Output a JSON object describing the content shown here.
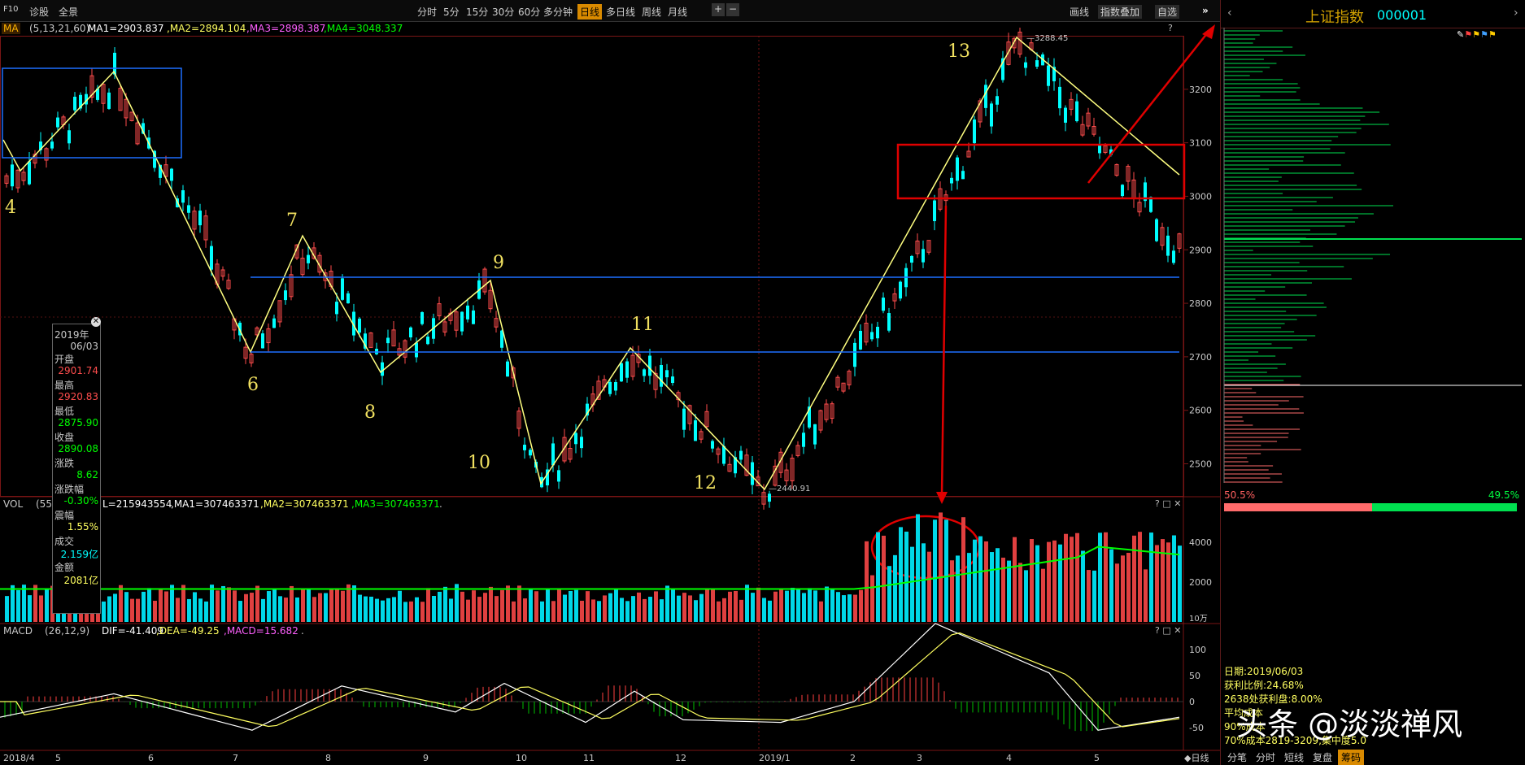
{
  "topbar": {
    "f10": "F10",
    "diagnose": "诊股",
    "fullview": "全景",
    "periods": [
      "分时",
      "5分",
      "15分",
      "30分",
      "60分",
      "多分钟",
      "日线",
      "多日线",
      "周线",
      "月线"
    ],
    "active_period": "日线",
    "add": "+",
    "remove": "−",
    "draw": "画线",
    "index_overlay": "指数叠加",
    "watchlist": "自选",
    "collapse": "»"
  },
  "ma_line": {
    "ma_button": "MA",
    "params": "(5,13,21,60)",
    "ma1": "MA1=2903.837",
    "ma2": ",MA2=2894.104",
    "ma3": ",MA3=2898.387",
    "ma4": ",MA4=3048.337"
  },
  "vol_line": {
    "name": "VOL",
    "params": "(55",
    "value": "L=215943554",
    "ma1": ",MA1=307463371",
    "ma2": ",MA2=307463371",
    "ma3": ",MA3=307463371",
    "trail": "."
  },
  "macd_line": {
    "name": "MACD",
    "params": "(26,12,9)",
    "dif": "DIF=-41.409",
    "dea": ",DEA=-49.25",
    "macd": ",MACD=15.682",
    "trail": "."
  },
  "price_axis": [
    "3200",
    "3100",
    "3000",
    "2900",
    "2800",
    "2700",
    "2600",
    "2500"
  ],
  "vol_axis": [
    "4000",
    "2000"
  ],
  "vol_unit": "10万",
  "macd_axis": [
    "100",
    "50",
    "0",
    "-50"
  ],
  "date_axis": [
    "2018/4",
    "5",
    "6",
    "7",
    "8",
    "9",
    "10",
    "11",
    "12",
    "2019/1",
    "2",
    "3",
    "4",
    "5"
  ],
  "date_mode": "日线",
  "high_label": "3288.45",
  "low_label": "2440.91",
  "wave_labels": [
    "4",
    "6",
    "7",
    "8",
    "9",
    "10",
    "11",
    "12",
    "13"
  ],
  "infobox": {
    "year": "2019年",
    "date": "06/03",
    "open_label": "开盘",
    "open": "2901.74",
    "high_label": "最高",
    "high": "2920.83",
    "low_label": "最低",
    "low": "2875.90",
    "close_label": "收盘",
    "close": "2890.08",
    "chg_label": "涨跌",
    "chg": "8.62",
    "chgpct_label": "涨跌幅",
    "chgpct": "-0.30%",
    "amp_label": "震幅",
    "amp": "1.55%",
    "vol_label": "成交",
    "vol": "2.159亿",
    "amt_label": "金额",
    "amt": "2081亿"
  },
  "side": {
    "title": "上证指数",
    "code": "000001",
    "pct_left": "50.5%",
    "pct_right": "49.5%",
    "date_line": "日期:2019/06/03",
    "profit_ratio": "获利比例:24.68%",
    "line3": "2638处获利盘:8.00%",
    "line4": "平均成本",
    "line5": "90%成本",
    "line6": "70%成本2819-3209,集中度5.0",
    "tabs": [
      "分笔",
      "分时",
      "短线",
      "复盘",
      "筹码"
    ],
    "active_tab": "筹码"
  },
  "watermark": "头条 @淡淡禅风",
  "colors": {
    "up": "#ff4d4d",
    "down": "#00ffff",
    "ma_yellow": "#ffff80",
    "macd_green": "#00c000",
    "red_box": "#e00000",
    "blue_line": "#1e6fff"
  }
}
